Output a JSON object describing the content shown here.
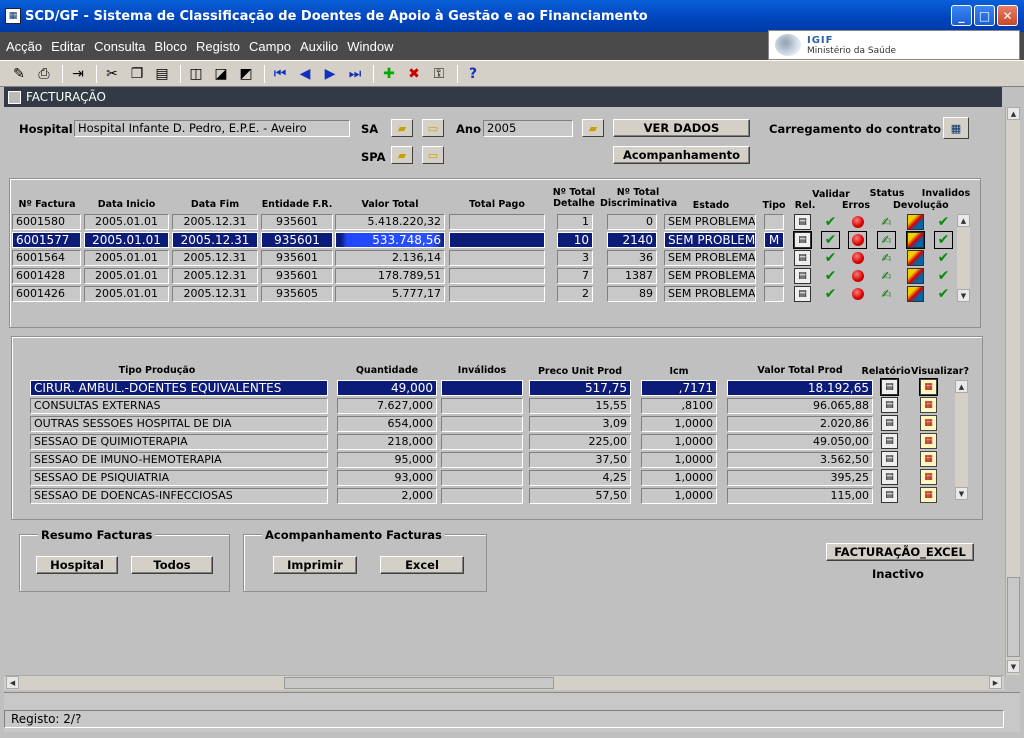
{
  "window": {
    "title": "SCD/GF - Sistema de Classificação de Doentes de Apoio à Gestão e ao Financiamento"
  },
  "menu": [
    "Acção",
    "Editar",
    "Consulta",
    "Bloco",
    "Registo",
    "Campo",
    "Auxilio",
    "Window"
  ],
  "logo": {
    "line1": "IGIF",
    "line2": "Ministério da Saúde"
  },
  "form": {
    "title": "FACTURAÇÃO"
  },
  "header": {
    "hospital_label": "Hospital",
    "hospital_value": "Hospital Infante D. Pedro, E.P.E. - Aveiro",
    "sa_label": "SA",
    "spa_label": "SPA",
    "ano_label": "Ano",
    "ano_value": "2005",
    "ver_dados": "VER DADOS",
    "acompanhamento": "Acompanhamento",
    "carregamento_label": "Carregamento do contrato"
  },
  "facturas": {
    "headers": {
      "nr": "Nº Factura",
      "inicio": "Data Inicio",
      "fim": "Data Fim",
      "entidade": "Entidade F.R.",
      "valor": "Valor Total",
      "pago": "Total Pago",
      "detalhe": "Nº Total Detalhe",
      "discr": "Nº Total Discriminativa",
      "estado": "Estado",
      "tipo": "Tipo",
      "rel": "Rel.",
      "validar": "Validar",
      "erros": "Erros",
      "status": "Status",
      "devolucao": "Devolução",
      "invalidos": "Invalidos"
    },
    "rows": [
      {
        "nr": "6001580",
        "inicio": "2005.01.01",
        "fim": "2005.12.31",
        "entidade": "935601",
        "valor": "5.418.220,32",
        "pago": "",
        "detalhe": "1",
        "discr": "0",
        "estado": "SEM PROBLEMA",
        "tipo": ""
      },
      {
        "nr": "6001577",
        "inicio": "2005.01.01",
        "fim": "2005.12.31",
        "entidade": "935601",
        "valor": "533.748,56",
        "pago": "",
        "detalhe": "10",
        "discr": "2140",
        "estado": "SEM PROBLEMA",
        "tipo": "M"
      },
      {
        "nr": "6001564",
        "inicio": "2005.01.01",
        "fim": "2005.12.31",
        "entidade": "935601",
        "valor": "2.136,14",
        "pago": "",
        "detalhe": "3",
        "discr": "36",
        "estado": "SEM PROBLEMA",
        "tipo": ""
      },
      {
        "nr": "6001428",
        "inicio": "2005.01.01",
        "fim": "2005.12.31",
        "entidade": "935601",
        "valor": "178.789,51",
        "pago": "",
        "detalhe": "7",
        "discr": "1387",
        "estado": "SEM PROBLEMA",
        "tipo": ""
      },
      {
        "nr": "6001426",
        "inicio": "2005.01.01",
        "fim": "2005.12.31",
        "entidade": "935605",
        "valor": "5.777,17",
        "pago": "",
        "detalhe": "2",
        "discr": "89",
        "estado": "SEM PROBLEMA",
        "tipo": ""
      }
    ]
  },
  "producao": {
    "headers": {
      "tipo": "Tipo Produção",
      "qtd": "Quantidade",
      "invalidos": "Inválidos",
      "preco": "Preco Unit Prod",
      "icm": "Icm",
      "valor": "Valor Total Prod",
      "relatorio": "Relatório",
      "visualizar": "Visualizar?"
    },
    "rows": [
      {
        "tipo": "CIRUR. AMBUL.-DOENTES EQUIVALENTES",
        "qtd": "49,000",
        "inv": "",
        "preco": "517,75",
        "icm": ",7171",
        "valor": "18.192,65"
      },
      {
        "tipo": "CONSULTAS EXTERNAS",
        "qtd": "7.627,000",
        "inv": "",
        "preco": "15,55",
        "icm": ",8100",
        "valor": "96.065,88"
      },
      {
        "tipo": "OUTRAS SESSOES HOSPITAL DE DIA",
        "qtd": "654,000",
        "inv": "",
        "preco": "3,09",
        "icm": "1,0000",
        "valor": "2.020,86"
      },
      {
        "tipo": "SESSAO DE QUIMIOTERAPIA",
        "qtd": "218,000",
        "inv": "",
        "preco": "225,00",
        "icm": "1,0000",
        "valor": "49.050,00"
      },
      {
        "tipo": "SESSAO DE IMUNO-HEMOTERAPIA",
        "qtd": "95,000",
        "inv": "",
        "preco": "37,50",
        "icm": "1,0000",
        "valor": "3.562,50"
      },
      {
        "tipo": "SESSAO DE PSIQUIATRIA",
        "qtd": "93,000",
        "inv": "",
        "preco": "4,25",
        "icm": "1,0000",
        "valor": "395,25"
      },
      {
        "tipo": "SESSAO DE DOENCAS-INFECCIOSAS",
        "qtd": "2,000",
        "inv": "",
        "preco": "57,50",
        "icm": "1,0000",
        "valor": "115,00"
      }
    ]
  },
  "resumo": {
    "title": "Resumo Facturas",
    "hospital": "Hospital",
    "todos": "Todos"
  },
  "acomp": {
    "title": "Acompanhamento Facturas",
    "imprimir": "Imprimir",
    "excel": "Excel"
  },
  "fact_excel": {
    "button": "FACTURAÇÃO_EXCEL",
    "status": "Inactivo"
  },
  "statusbar": {
    "text": "Registo: 2/?"
  }
}
